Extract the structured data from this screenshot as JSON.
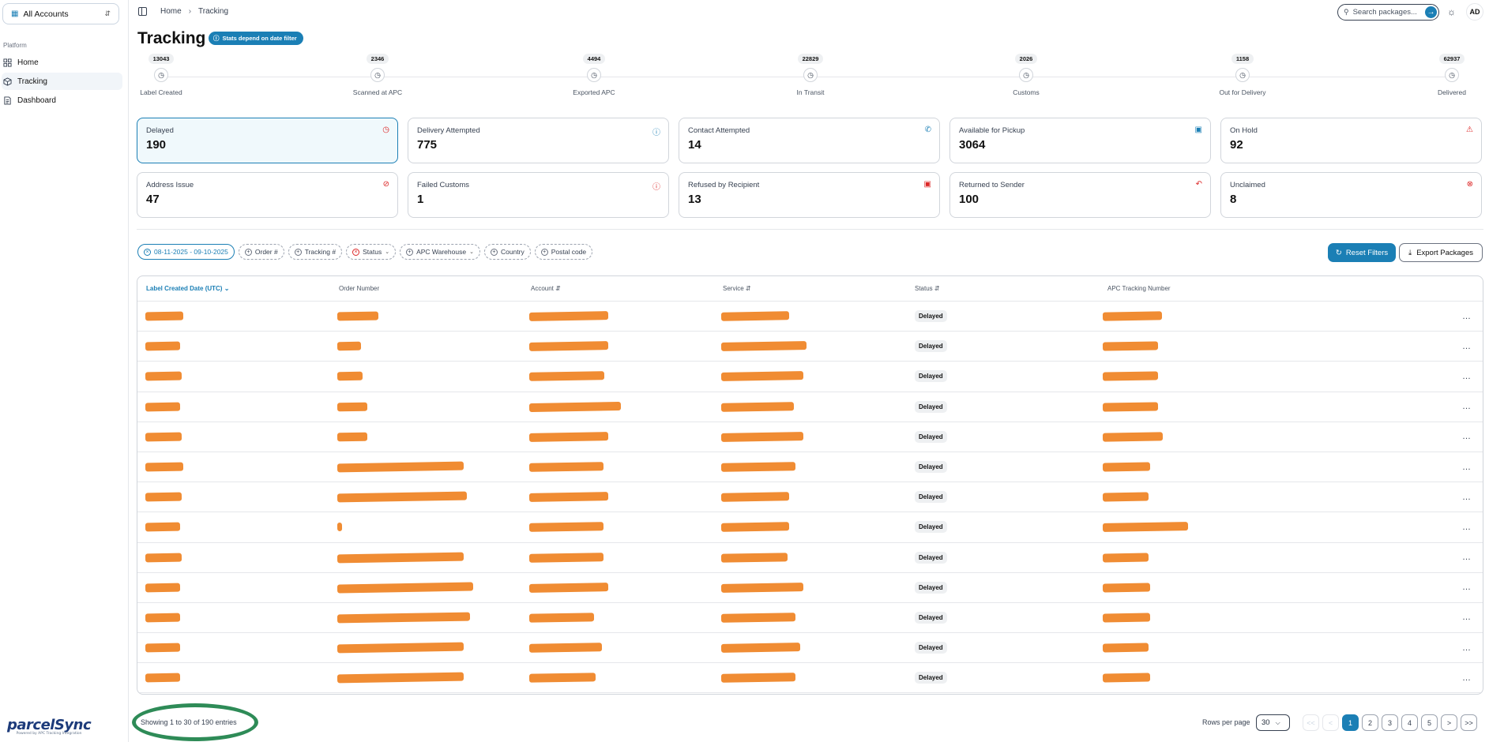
{
  "sidebar": {
    "account_select": "All Accounts",
    "section_label": "Platform",
    "items": [
      {
        "label": "Home",
        "icon": "grid-icon"
      },
      {
        "label": "Tracking",
        "icon": "box-icon"
      },
      {
        "label": "Dashboard",
        "icon": "document-icon"
      }
    ],
    "logo_text": "parcelSync",
    "logo_tagline": "Powered by APC Tracking Integration"
  },
  "topbar": {
    "breadcrumb": [
      "Home",
      "Tracking"
    ],
    "search_placeholder": "Search packages...",
    "avatar": "AD"
  },
  "page": {
    "title": "Tracking",
    "stats_note": "Stats depend on date filter"
  },
  "timeline": [
    {
      "count": "13043",
      "label": "Label Created"
    },
    {
      "count": "2346",
      "label": "Scanned at APC"
    },
    {
      "count": "4494",
      "label": "Exported APC"
    },
    {
      "count": "22829",
      "label": "In Transit"
    },
    {
      "count": "2026",
      "label": "Customs"
    },
    {
      "count": "1158",
      "label": "Out for Delivery"
    },
    {
      "count": "62937",
      "label": "Delivered"
    }
  ],
  "cards": [
    {
      "label": "Delayed",
      "value": "190",
      "icon": "clock-icon",
      "color": "#dc2626"
    },
    {
      "label": "Delivery Attempted",
      "value": "775",
      "icon": "question-icon",
      "color": "#1b7fb5"
    },
    {
      "label": "Contact Attempted",
      "value": "14",
      "icon": "phone-icon",
      "color": "#1b7fb5"
    },
    {
      "label": "Available for Pickup",
      "value": "3064",
      "icon": "package-icon",
      "color": "#1b7fb5"
    },
    {
      "label": "On Hold",
      "value": "92",
      "icon": "warning-icon",
      "color": "#dc2626"
    },
    {
      "label": "Address Issue",
      "value": "47",
      "icon": "location-off-icon",
      "color": "#dc2626"
    },
    {
      "label": "Failed Customs",
      "value": "1",
      "icon": "alert-circle-icon",
      "color": "#dc2626"
    },
    {
      "label": "Refused by Recipient",
      "value": "13",
      "icon": "package-x-icon",
      "color": "#dc2626"
    },
    {
      "label": "Returned to Sender",
      "value": "100",
      "icon": "undo-icon",
      "color": "#dc2626"
    },
    {
      "label": "Unclaimed",
      "value": "8",
      "icon": "x-circle-icon",
      "color": "#dc2626"
    }
  ],
  "filters": {
    "date_range": "08-11-2025 - 09-10-2025",
    "order": "Order #",
    "tracking": "Tracking #",
    "status": "Status",
    "warehouse": "APC Warehouse",
    "country": "Country",
    "postal": "Postal code",
    "reset_label": "Reset Filters",
    "export_label": "Export Packages"
  },
  "table": {
    "columns": [
      "Label Created Date (UTC)",
      "Order Number",
      "Account",
      "Service",
      "Status",
      "APC Tracking Number"
    ],
    "status_value": "Delayed",
    "row_count": 13
  },
  "footer": {
    "showing": "Showing 1 to 30 of 190 entries",
    "rows_per_page_label": "Rows per page",
    "rows_per_page_value": "30",
    "pages": [
      "1",
      "2",
      "3",
      "4",
      "5"
    ],
    "first": "<<",
    "prev": "<",
    "next": ">",
    "last": ">>"
  }
}
